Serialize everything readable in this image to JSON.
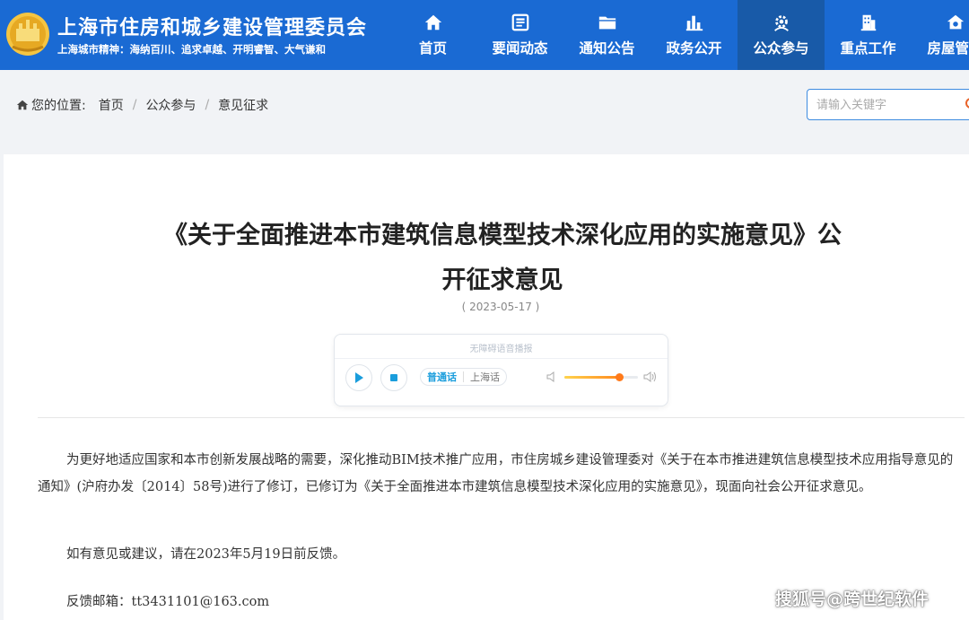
{
  "header": {
    "site_title": "上海市住房和城乡建设管理委员会",
    "site_motto": "上海城市精神：海纳百川、追求卓越、开明睿智、大气谦和",
    "nav": [
      {
        "label": "首页",
        "icon": "home-icon"
      },
      {
        "label": "要闻动态",
        "icon": "newspaper-icon"
      },
      {
        "label": "通知公告",
        "icon": "folder-icon"
      },
      {
        "label": "政务公开",
        "icon": "bar-chart-icon"
      },
      {
        "label": "公众参与",
        "icon": "gear-people-icon",
        "active": true
      },
      {
        "label": "重点工作",
        "icon": "building-icon"
      },
      {
        "label": "房屋管理",
        "icon": "house-gear-icon"
      }
    ],
    "colors": {
      "bar": "#1a6ad3",
      "active": "#185aa8"
    }
  },
  "breadcrumb": {
    "prefix": "您的位置:",
    "items": [
      "首页",
      "公众参与",
      "意见征求"
    ],
    "separator": "/"
  },
  "search": {
    "placeholder": "请输入关键字"
  },
  "article": {
    "title_line1": "《关于全面推进本市建筑信息模型技术深化应用的实施意见》公",
    "title_line2": "开征求意见",
    "date": "( 2023-05-17 )",
    "paragraph1": "为更好地适应国家和本市创新发展战略的需要，深化推动BIM技术推广应用，市住房城乡建设管理委对《关于在本市推进建筑信息模型技术应用指导意见的通知》(沪府办发〔2014〕58号)进行了修订，已修订为《关于全面推进本市建筑信息模型技术深化应用的实施意见》，现面向社会公开征求意见。",
    "paragraph2": "如有意见或建议，请在2023年5月19日前反馈。",
    "paragraph3": "反馈邮箱：tt3431101@163.com"
  },
  "player": {
    "label": "无障碍语音播报",
    "languages": [
      "普通话",
      "上海话"
    ],
    "active_language": "普通话",
    "volume": 0.74
  },
  "watermark": "搜狐号@跨世纪软件"
}
